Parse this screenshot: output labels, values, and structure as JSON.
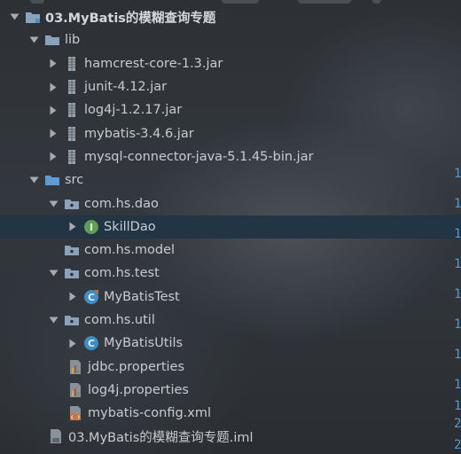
{
  "colors": {
    "selection": "#213545",
    "folder": "#8aa3bb",
    "source_folder": "#5d9bd4",
    "interface_badge": "#5f9d55",
    "class_badge": "#3b8fc6"
  },
  "tree": {
    "project": {
      "label": "03.MyBatis的模糊查询专题",
      "icon": "module-folder-icon"
    },
    "lib": {
      "label": "lib",
      "icon": "folder-icon",
      "jars": [
        {
          "label": "hamcrest-core-1.3.jar",
          "icon": "jar-icon"
        },
        {
          "label": "junit-4.12.jar",
          "icon": "jar-icon"
        },
        {
          "label": "log4j-1.2.17.jar",
          "icon": "jar-icon"
        },
        {
          "label": "mybatis-3.4.6.jar",
          "icon": "jar-icon"
        },
        {
          "label": "mysql-connector-java-5.1.45-bin.jar",
          "icon": "jar-icon"
        }
      ]
    },
    "src": {
      "label": "src",
      "icon": "source-folder-icon",
      "packages": {
        "dao": {
          "label": "com.hs.dao",
          "child": {
            "label": "SkillDao",
            "icon": "interface-icon",
            "badge": "I"
          }
        },
        "model": {
          "label": "com.hs.model"
        },
        "test": {
          "label": "com.hs.test",
          "child": {
            "label": "MyBatisTest",
            "icon": "test-class-icon",
            "badge": "C"
          }
        },
        "util": {
          "label": "com.hs.util",
          "child": {
            "label": "MyBatisUtils",
            "icon": "class-icon",
            "badge": "C"
          }
        }
      },
      "files": [
        {
          "label": "jdbc.properties",
          "icon": "properties-file-icon"
        },
        {
          "label": "log4j.properties",
          "icon": "properties-file-icon"
        },
        {
          "label": "mybatis-config.xml",
          "icon": "xml-file-icon"
        }
      ]
    },
    "iml": {
      "label": "03.MyBatis的模糊查询专题.iml",
      "icon": "iml-file-icon"
    }
  },
  "gutter": [
    "1",
    "1",
    "1",
    "1",
    "1",
    "1",
    "1",
    "1",
    "1",
    "1",
    "2",
    "2"
  ]
}
